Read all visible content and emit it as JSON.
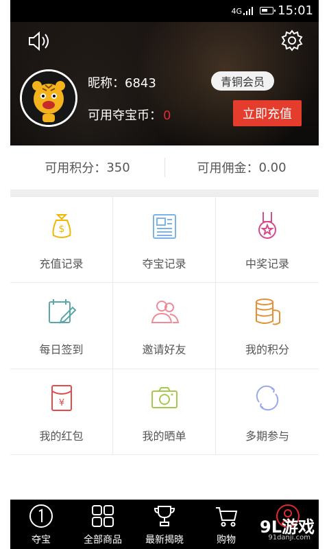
{
  "status": {
    "network": "4G",
    "time": "15:01"
  },
  "profile": {
    "nickname_label": "昵称：",
    "nickname_value": "6843",
    "level": "青铜会员",
    "coins_label": "可用夺宝币：",
    "coins_value": "0",
    "recharge_label": "立即充值"
  },
  "summary": {
    "points_label": "可用积分：",
    "points_value": "350",
    "commission_label": "可用佣金：",
    "commission_value": "0.00"
  },
  "grid": [
    {
      "label": "充值记录",
      "icon": "money-bag-icon",
      "color": "#f2b400"
    },
    {
      "label": "夺宝记录",
      "icon": "document-icon",
      "color": "#7bb3e6"
    },
    {
      "label": "中奖记录",
      "icon": "medal-icon",
      "color": "#d84a8e"
    },
    {
      "label": "每日签到",
      "icon": "calendar-pencil-icon",
      "color": "#5aa6a8"
    },
    {
      "label": "邀请好友",
      "icon": "friends-icon",
      "color": "#f08a98"
    },
    {
      "label": "我的积分",
      "icon": "coins-stack-icon",
      "color": "#e78f34"
    },
    {
      "label": "我的红包",
      "icon": "red-envelope-icon",
      "color": "#e34a4a"
    },
    {
      "label": "我的晒单",
      "icon": "camera-icon",
      "color": "#a6c84b"
    },
    {
      "label": "多期参与",
      "icon": "refresh-icon",
      "color": "#9aa7e8"
    }
  ],
  "nav": [
    {
      "label": "夺宝",
      "icon": "number-one-icon"
    },
    {
      "label": "全部商品",
      "icon": "grid-icon"
    },
    {
      "label": "最新揭晓",
      "icon": "trophy-icon"
    },
    {
      "label": "购物",
      "icon": "cart-icon"
    },
    {
      "label": "",
      "icon": "profile-icon"
    }
  ],
  "watermark": {
    "brand": "9L游戏",
    "site": "91danji.com"
  },
  "colors": {
    "accent_red": "#e43d2e",
    "background": "#ffffff"
  }
}
